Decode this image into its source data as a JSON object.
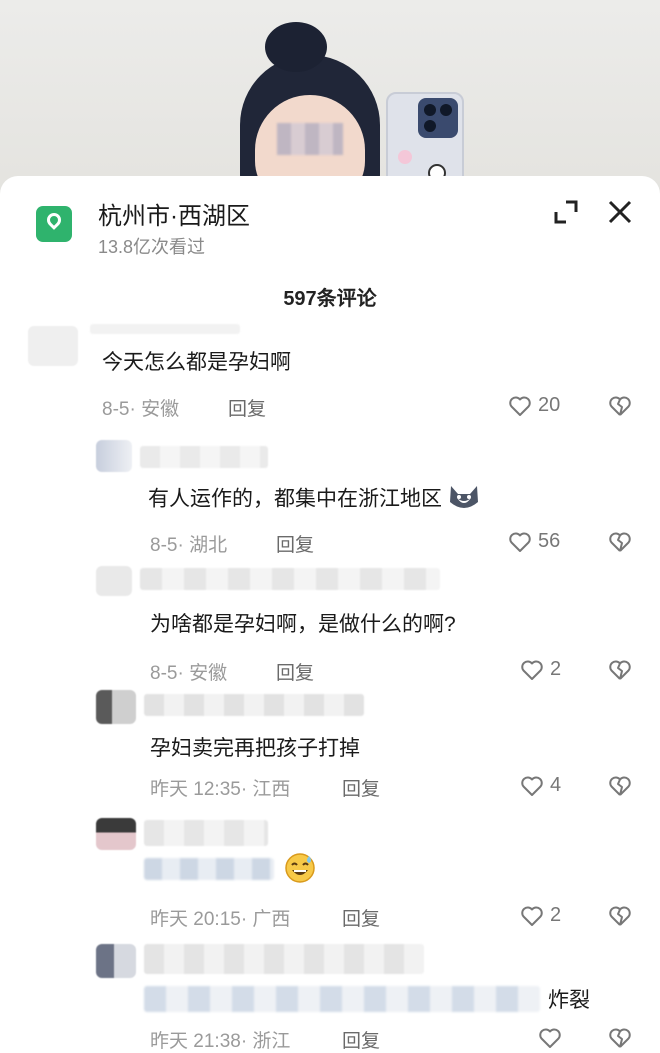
{
  "location": {
    "title": "杭州市·西湖区",
    "views": "13.8亿次看过"
  },
  "comment_header": {
    "count": "597条评论"
  },
  "comments": [
    {
      "text": "今天怎么都是孕妇啊",
      "date_region": "8-5· 安徽",
      "reply": "回复",
      "likes": "20"
    },
    {
      "text": "有人运作的，都集中在浙江地区",
      "date_region": "8-5· 湖北",
      "reply": "回复",
      "likes": "56"
    },
    {
      "text": "为啥都是孕妇啊，是做什么的啊?",
      "date_region": "8-5· 安徽",
      "reply": "回复",
      "likes": "2"
    },
    {
      "text": "孕妇卖完再把孩子打掉",
      "date_region": "昨天 12:35· 江西",
      "reply": "回复",
      "likes": "4"
    },
    {
      "text": "",
      "date_region": "昨天 20:15· 广西",
      "reply": "回复",
      "likes": "2"
    },
    {
      "text": "炸裂",
      "date_region": "昨天 21:38· 浙江",
      "reply": "回复",
      "likes": ""
    }
  ],
  "icons": {
    "location": "location-pin-icon",
    "expand": "expand-icon",
    "close": "close-icon",
    "like": "heart-icon",
    "dislike": "broken-heart-icon",
    "emoji_dog": "husky-emoji-icon",
    "emoji_laugh": "sweat-smile-emoji-icon"
  },
  "colors": {
    "location_badge": "#2fb36d",
    "text_primary": "#1a1a1a",
    "text_secondary": "#9a9a9a"
  }
}
